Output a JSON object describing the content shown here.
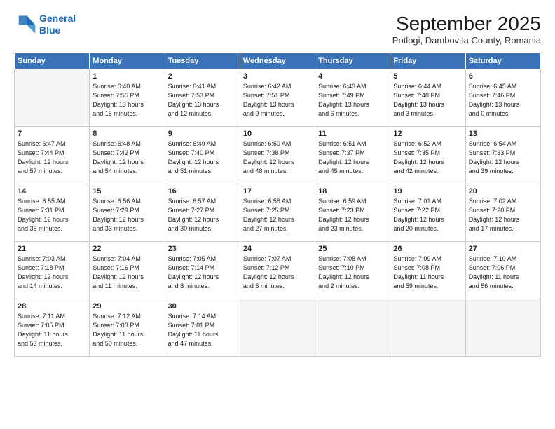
{
  "logo": {
    "line1": "General",
    "line2": "Blue"
  },
  "title": "September 2025",
  "location": "Potlogi, Dambovita County, Romania",
  "weekdays": [
    "Sunday",
    "Monday",
    "Tuesday",
    "Wednesday",
    "Thursday",
    "Friday",
    "Saturday"
  ],
  "weeks": [
    [
      {
        "day": "",
        "info": ""
      },
      {
        "day": "1",
        "info": "Sunrise: 6:40 AM\nSunset: 7:55 PM\nDaylight: 13 hours\nand 15 minutes."
      },
      {
        "day": "2",
        "info": "Sunrise: 6:41 AM\nSunset: 7:53 PM\nDaylight: 13 hours\nand 12 minutes."
      },
      {
        "day": "3",
        "info": "Sunrise: 6:42 AM\nSunset: 7:51 PM\nDaylight: 13 hours\nand 9 minutes."
      },
      {
        "day": "4",
        "info": "Sunrise: 6:43 AM\nSunset: 7:49 PM\nDaylight: 13 hours\nand 6 minutes."
      },
      {
        "day": "5",
        "info": "Sunrise: 6:44 AM\nSunset: 7:48 PM\nDaylight: 13 hours\nand 3 minutes."
      },
      {
        "day": "6",
        "info": "Sunrise: 6:45 AM\nSunset: 7:46 PM\nDaylight: 13 hours\nand 0 minutes."
      }
    ],
    [
      {
        "day": "7",
        "info": "Sunrise: 6:47 AM\nSunset: 7:44 PM\nDaylight: 12 hours\nand 57 minutes."
      },
      {
        "day": "8",
        "info": "Sunrise: 6:48 AM\nSunset: 7:42 PM\nDaylight: 12 hours\nand 54 minutes."
      },
      {
        "day": "9",
        "info": "Sunrise: 6:49 AM\nSunset: 7:40 PM\nDaylight: 12 hours\nand 51 minutes."
      },
      {
        "day": "10",
        "info": "Sunrise: 6:50 AM\nSunset: 7:38 PM\nDaylight: 12 hours\nand 48 minutes."
      },
      {
        "day": "11",
        "info": "Sunrise: 6:51 AM\nSunset: 7:37 PM\nDaylight: 12 hours\nand 45 minutes."
      },
      {
        "day": "12",
        "info": "Sunrise: 6:52 AM\nSunset: 7:35 PM\nDaylight: 12 hours\nand 42 minutes."
      },
      {
        "day": "13",
        "info": "Sunrise: 6:54 AM\nSunset: 7:33 PM\nDaylight: 12 hours\nand 39 minutes."
      }
    ],
    [
      {
        "day": "14",
        "info": "Sunrise: 6:55 AM\nSunset: 7:31 PM\nDaylight: 12 hours\nand 36 minutes."
      },
      {
        "day": "15",
        "info": "Sunrise: 6:56 AM\nSunset: 7:29 PM\nDaylight: 12 hours\nand 33 minutes."
      },
      {
        "day": "16",
        "info": "Sunrise: 6:57 AM\nSunset: 7:27 PM\nDaylight: 12 hours\nand 30 minutes."
      },
      {
        "day": "17",
        "info": "Sunrise: 6:58 AM\nSunset: 7:25 PM\nDaylight: 12 hours\nand 27 minutes."
      },
      {
        "day": "18",
        "info": "Sunrise: 6:59 AM\nSunset: 7:23 PM\nDaylight: 12 hours\nand 23 minutes."
      },
      {
        "day": "19",
        "info": "Sunrise: 7:01 AM\nSunset: 7:22 PM\nDaylight: 12 hours\nand 20 minutes."
      },
      {
        "day": "20",
        "info": "Sunrise: 7:02 AM\nSunset: 7:20 PM\nDaylight: 12 hours\nand 17 minutes."
      }
    ],
    [
      {
        "day": "21",
        "info": "Sunrise: 7:03 AM\nSunset: 7:18 PM\nDaylight: 12 hours\nand 14 minutes."
      },
      {
        "day": "22",
        "info": "Sunrise: 7:04 AM\nSunset: 7:16 PM\nDaylight: 12 hours\nand 11 minutes."
      },
      {
        "day": "23",
        "info": "Sunrise: 7:05 AM\nSunset: 7:14 PM\nDaylight: 12 hours\nand 8 minutes."
      },
      {
        "day": "24",
        "info": "Sunrise: 7:07 AM\nSunset: 7:12 PM\nDaylight: 12 hours\nand 5 minutes."
      },
      {
        "day": "25",
        "info": "Sunrise: 7:08 AM\nSunset: 7:10 PM\nDaylight: 12 hours\nand 2 minutes."
      },
      {
        "day": "26",
        "info": "Sunrise: 7:09 AM\nSunset: 7:08 PM\nDaylight: 11 hours\nand 59 minutes."
      },
      {
        "day": "27",
        "info": "Sunrise: 7:10 AM\nSunset: 7:06 PM\nDaylight: 11 hours\nand 56 minutes."
      }
    ],
    [
      {
        "day": "28",
        "info": "Sunrise: 7:11 AM\nSunset: 7:05 PM\nDaylight: 11 hours\nand 53 minutes."
      },
      {
        "day": "29",
        "info": "Sunrise: 7:12 AM\nSunset: 7:03 PM\nDaylight: 11 hours\nand 50 minutes."
      },
      {
        "day": "30",
        "info": "Sunrise: 7:14 AM\nSunset: 7:01 PM\nDaylight: 11 hours\nand 47 minutes."
      },
      {
        "day": "",
        "info": ""
      },
      {
        "day": "",
        "info": ""
      },
      {
        "day": "",
        "info": ""
      },
      {
        "day": "",
        "info": ""
      }
    ]
  ]
}
